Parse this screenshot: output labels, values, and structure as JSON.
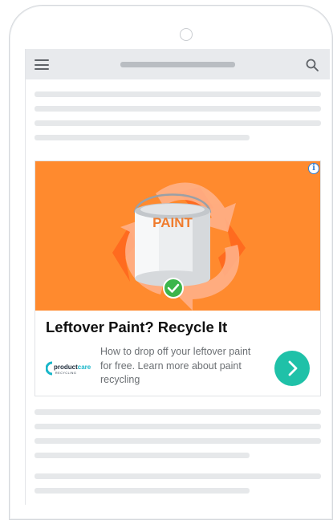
{
  "ad": {
    "headline": "Leftover Paint? Recycle It",
    "description": "How to drop off your leftover paint for free. Learn more about paint recycling",
    "image_label": "PAINT",
    "brand": {
      "name_part1": "product",
      "name_part2": "care",
      "tagline": "RECYCLING"
    },
    "colors": {
      "image_background": "#ff8a2e",
      "cta": "#1fc1a8",
      "info": "#2f7fd6",
      "check": "#3cb54a"
    }
  },
  "icons": {
    "menu": "hamburger-menu-icon",
    "search": "search-icon",
    "info": "info-icon",
    "cta": "chevron-right-icon",
    "check": "checkmark-icon",
    "recycle": "recycle-icon"
  }
}
